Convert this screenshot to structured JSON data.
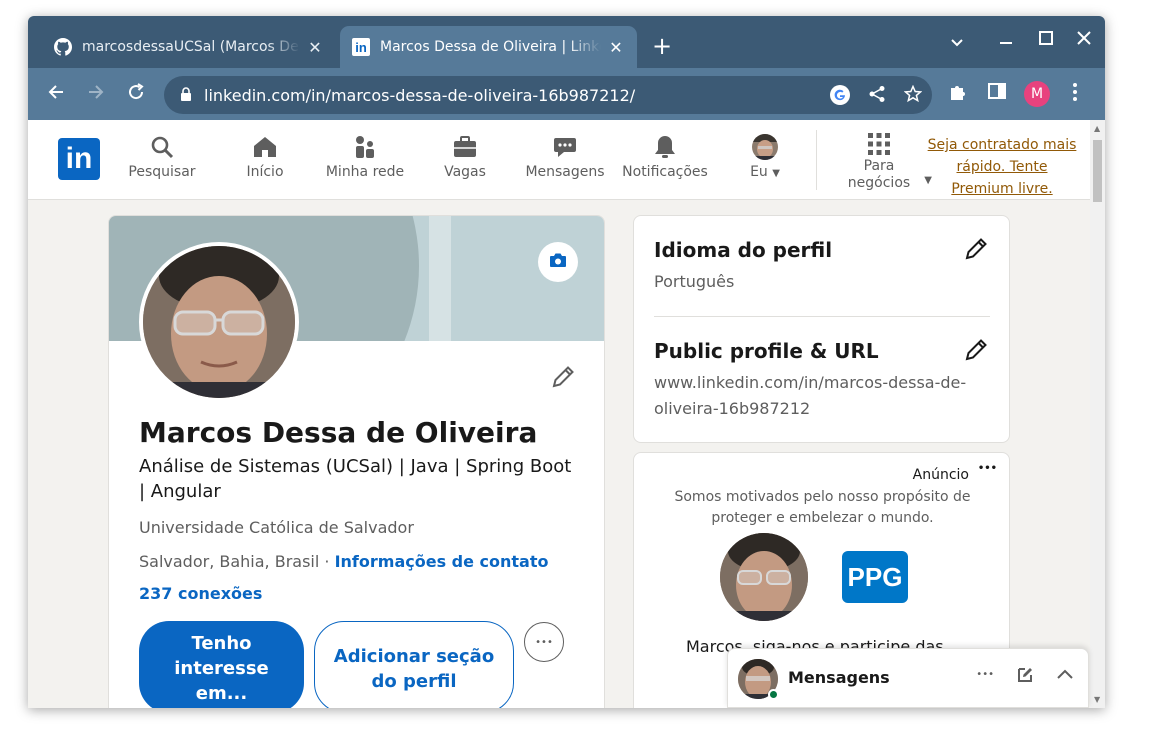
{
  "browser": {
    "tabs": [
      {
        "title": "marcosdessaUCSal (Marcos Dessa de Oliveira)",
        "active": false,
        "favicon": "github-icon"
      },
      {
        "title": "Marcos Dessa de Oliveira | LinkedIn",
        "active": true,
        "favicon": "linkedin-icon"
      }
    ],
    "close_glyph": "✕",
    "new_tab_glyph": "+",
    "url": "linkedin.com/in/marcos-dessa-de-oliveira-16b987212/",
    "profile_initial": "M"
  },
  "linkedin_nav": {
    "logo": "in",
    "items": [
      {
        "label": "Pesquisar",
        "icon": "search-icon"
      },
      {
        "label": "Início",
        "icon": "home-icon"
      },
      {
        "label": "Minha rede",
        "icon": "network-icon"
      },
      {
        "label": "Vagas",
        "icon": "briefcase-icon"
      },
      {
        "label": "Mensagens",
        "icon": "chat-icon"
      },
      {
        "label": "Notificações",
        "icon": "bell-icon"
      },
      {
        "label": "Eu",
        "icon": "avatar"
      }
    ],
    "business_label_1": "Para",
    "business_label_2": "negócios",
    "premium_line_1": "Seja contratado mais",
    "premium_line_2": "rápido. Tente",
    "premium_line_3": "Premium livre."
  },
  "profile": {
    "name": "Marcos Dessa de Oliveira",
    "headline": "Análise de Sistemas (UCSal) | Java | Spring Boot | Angular",
    "school": "Universidade Católica de Salvador",
    "location": "Salvador, Bahia, Brasil",
    "location_sep": " · ",
    "contact_link": "Informações de contato",
    "connections": "237 conexões",
    "btn_interest_1": "Tenho",
    "btn_interest_2": "interesse",
    "btn_interest_3": "em...",
    "btn_add_1": "Adicionar seção",
    "btn_add_2": "do perfil",
    "more_glyph": "•••"
  },
  "right_panel": {
    "language_title": "Idioma do perfil",
    "language_value": "Português",
    "public_title": "Public profile & URL",
    "public_value": "www.linkedin.com/in/marcos-dessa-de-oliveira-16b987212"
  },
  "ad": {
    "label": "Anúncio",
    "dots": "•••",
    "text": "Somos motivados pelo nosso propósito de proteger e embelezar o mundo.",
    "company_logo": "PPG",
    "bottom_text": "Marcos, siga-nos e participe das"
  },
  "messages": {
    "title": "Mensagens",
    "dots": "•••"
  },
  "colors": {
    "linkedin_blue": "#0a66c2",
    "premium_gold": "#915907",
    "chrome_frame": "#3c5a75",
    "chrome_toolbar": "#567a99",
    "online_green": "#057642"
  }
}
